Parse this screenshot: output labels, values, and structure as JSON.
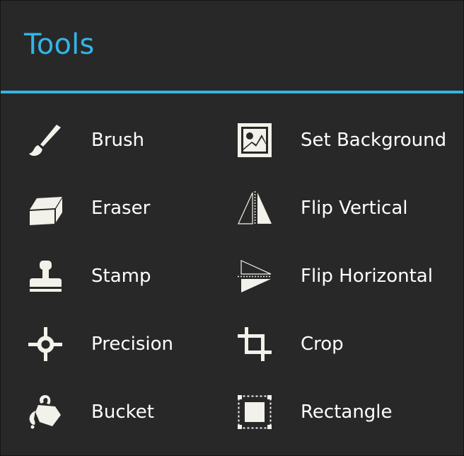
{
  "dialog": {
    "title": "Tools"
  },
  "colors": {
    "accent": "#33b5e5",
    "background": "#282828",
    "icon": "#f2f1ea",
    "text": "#ffffff"
  },
  "tools": [
    {
      "label": "Brush",
      "icon": "brush-icon"
    },
    {
      "label": "Eraser",
      "icon": "eraser-icon"
    },
    {
      "label": "Stamp",
      "icon": "stamp-icon"
    },
    {
      "label": "Precision",
      "icon": "crosshair-icon"
    },
    {
      "label": "Bucket",
      "icon": "paint-bucket-icon"
    },
    {
      "label": "Set Background",
      "icon": "image-icon"
    },
    {
      "label": "Flip Vertical",
      "icon": "flip-vertical-icon"
    },
    {
      "label": "Flip Horizontal",
      "icon": "flip-horizontal-icon"
    },
    {
      "label": "Crop",
      "icon": "crop-icon"
    },
    {
      "label": "Rectangle",
      "icon": "rectangle-select-icon"
    }
  ]
}
